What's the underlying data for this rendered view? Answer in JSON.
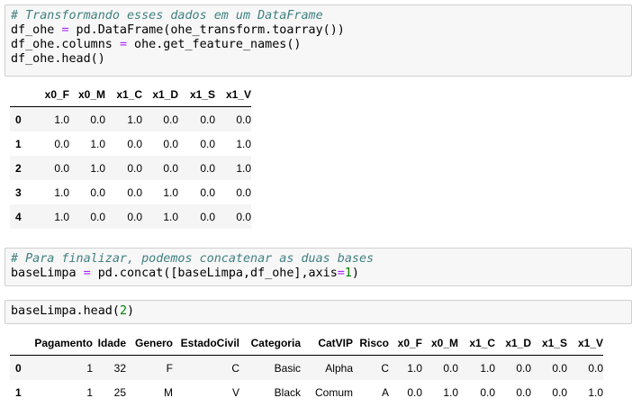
{
  "cells": {
    "cell1": [
      {
        "kind": "comment",
        "text": "# Transformando esses dados em um DataFrame"
      },
      {
        "kind": "code",
        "parts": [
          [
            "t",
            "df_ohe "
          ],
          [
            "op",
            "="
          ],
          [
            "t",
            " pd.DataFrame(ohe_transform.toarray())"
          ]
        ]
      },
      {
        "kind": "code",
        "parts": [
          [
            "t",
            "df_ohe.columns "
          ],
          [
            "op",
            "="
          ],
          [
            "t",
            " ohe.get_feature_names()"
          ]
        ]
      },
      {
        "kind": "code",
        "parts": [
          [
            "t",
            "df_ohe.head()"
          ]
        ]
      }
    ],
    "cell2": [
      {
        "kind": "comment",
        "text": "# Para finalizar, podemos concatenar as duas bases"
      },
      {
        "kind": "code",
        "parts": [
          [
            "t",
            "baseLimpa "
          ],
          [
            "op",
            "="
          ],
          [
            "t",
            " pd.concat([baseLimpa,df_ohe],axis"
          ],
          [
            "op",
            "="
          ],
          [
            "num",
            "1"
          ],
          [
            "t",
            ")"
          ]
        ]
      }
    ],
    "cell3": [
      {
        "kind": "code",
        "parts": [
          [
            "t",
            "baseLimpa.head("
          ],
          [
            "num",
            "2"
          ],
          [
            "t",
            ")"
          ]
        ]
      }
    ]
  },
  "table1": {
    "columns": [
      "x0_F",
      "x0_M",
      "x1_C",
      "x1_D",
      "x1_S",
      "x1_V"
    ],
    "rows": [
      {
        "index": "0",
        "values": [
          "1.0",
          "0.0",
          "1.0",
          "0.0",
          "0.0",
          "0.0"
        ]
      },
      {
        "index": "1",
        "values": [
          "0.0",
          "1.0",
          "0.0",
          "0.0",
          "0.0",
          "1.0"
        ]
      },
      {
        "index": "2",
        "values": [
          "0.0",
          "1.0",
          "0.0",
          "0.0",
          "0.0",
          "1.0"
        ]
      },
      {
        "index": "3",
        "values": [
          "1.0",
          "0.0",
          "0.0",
          "1.0",
          "0.0",
          "0.0"
        ]
      },
      {
        "index": "4",
        "values": [
          "1.0",
          "0.0",
          "0.0",
          "1.0",
          "0.0",
          "0.0"
        ]
      }
    ]
  },
  "table2": {
    "columns": [
      "Pagamento",
      "Idade",
      "Genero",
      "EstadoCivil",
      "Categoria",
      "CatVIP",
      "Risco",
      "x0_F",
      "x0_M",
      "x1_C",
      "x1_D",
      "x1_S",
      "x1_V"
    ],
    "rows": [
      {
        "index": "0",
        "values": [
          "1",
          "32",
          "F",
          "C",
          "Basic",
          "Alpha",
          "C",
          "1.0",
          "0.0",
          "1.0",
          "0.0",
          "0.0",
          "0.0"
        ]
      },
      {
        "index": "1",
        "values": [
          "1",
          "25",
          "M",
          "V",
          "Black",
          "Comum",
          "A",
          "0.0",
          "1.0",
          "0.0",
          "0.0",
          "0.0",
          "1.0"
        ]
      }
    ]
  }
}
